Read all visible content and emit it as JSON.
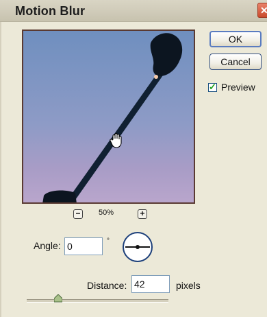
{
  "dialog": {
    "title": "Motion Blur",
    "close_glyph": "✕"
  },
  "buttons": {
    "ok": "OK",
    "cancel": "Cancel"
  },
  "preview_checkbox": {
    "label": "Preview",
    "checked": true
  },
  "zoom": {
    "minus": "−",
    "plus": "+",
    "level": "50%"
  },
  "angle": {
    "label": "Angle:",
    "value": "0",
    "unit": "°"
  },
  "distance": {
    "label": "Distance:",
    "value": "42",
    "unit": "pixels",
    "slider_fraction": 0.24
  },
  "icons": {
    "cursor": "hand-grab-icon",
    "dial": "angle-dial-icon"
  },
  "colors": {
    "accent": "#2f4c7e",
    "check": "#21a121"
  }
}
